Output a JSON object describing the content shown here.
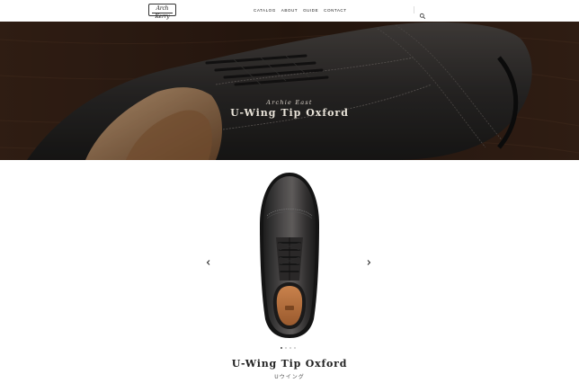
{
  "header": {
    "logo_text": "Arch Kerry",
    "nav": [
      "CATALOG",
      "ABOUT",
      "GUIDE",
      "CONTACT"
    ],
    "search_icon": "search-icon"
  },
  "hero": {
    "subtitle": "Archie East",
    "title": "U-Wing Tip Oxford"
  },
  "carousel": {
    "prev_icon": "chevron-left-icon",
    "next_icon": "chevron-right-icon",
    "slide_count": 4,
    "active_slide": 1
  },
  "product": {
    "name": "U-Wing Tip Oxford",
    "name_jp": "Uウイング"
  },
  "colors": {
    "hero_bg": "#2a1c14",
    "shoe_leather": "#2b2b2b",
    "insole": "#b06a3a"
  }
}
